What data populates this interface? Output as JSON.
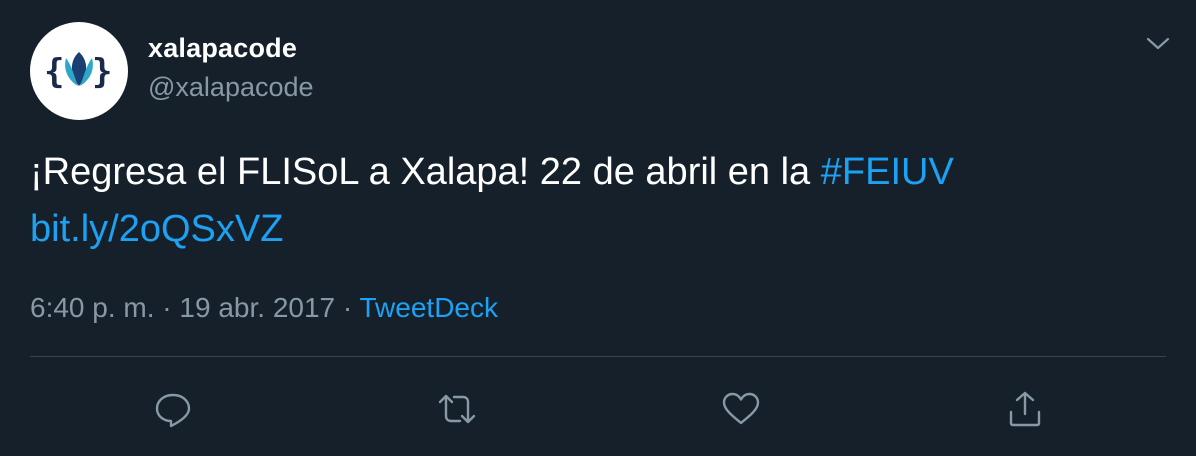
{
  "author": {
    "display_name": "xalapacode",
    "handle": "@xalapacode"
  },
  "tweet": {
    "text_before": "¡Regresa el FLISoL a Xalapa! 22 de abril en la ",
    "hashtag": "#FEIUV",
    "link": "bit.ly/2oQSxVZ"
  },
  "meta": {
    "time": "6:40 p. m.",
    "separator_1": " · ",
    "date": "19 abr. 2017",
    "separator_2": " · ",
    "source": "TweetDeck"
  },
  "icons": {
    "avatar": "xalapacode-logo",
    "caret": "chevron-down-icon",
    "reply": "reply-icon",
    "retweet": "retweet-icon",
    "like": "like-icon",
    "share": "share-icon"
  },
  "colors": {
    "background": "#15202b",
    "text": "#ffffff",
    "secondary_text": "#8899a6",
    "link": "#1da1f2",
    "divider": "#38444d"
  }
}
